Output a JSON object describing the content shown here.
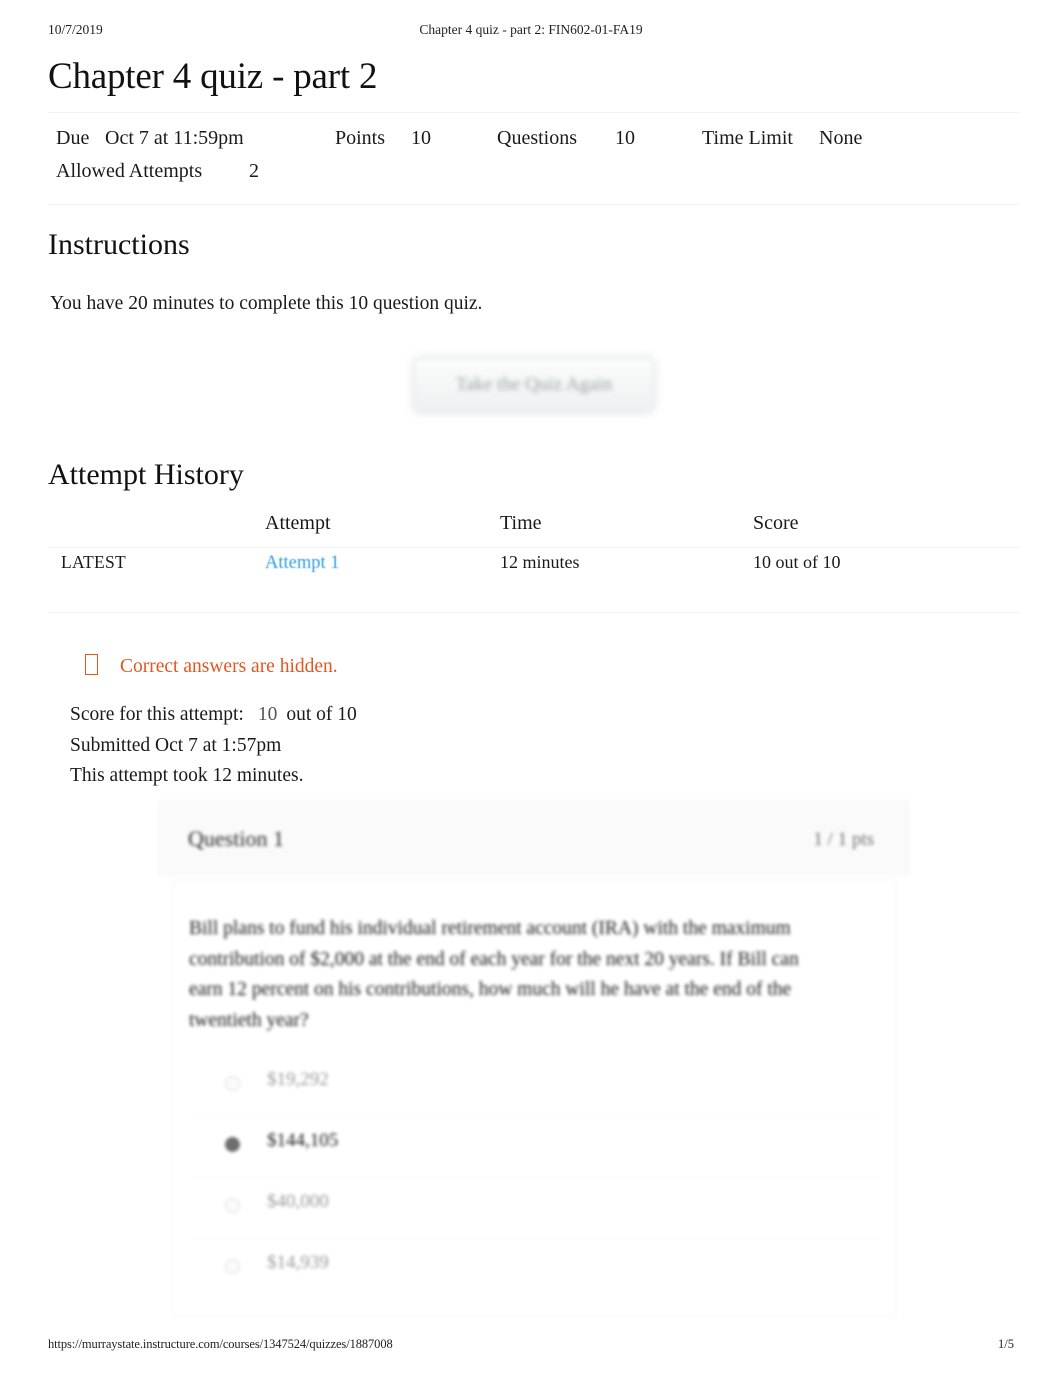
{
  "print_header": {
    "date": "10/7/2019",
    "title": "Chapter 4 quiz - part 2: FIN602-01-FA19"
  },
  "print_footer": {
    "url": "https://murraystate.instructure.com/courses/1347524/quizzes/1887008",
    "page": "1/5"
  },
  "quiz": {
    "title": "Chapter 4 quiz - part 2",
    "details": {
      "due_label": "Due",
      "due_value": "Oct 7 at 11:59pm",
      "points_label": "Points",
      "points_value": "10",
      "questions_label": "Questions",
      "questions_value": "10",
      "time_limit_label": "Time Limit",
      "time_limit_value": "None",
      "allowed_attempts_label": "Allowed Attempts",
      "allowed_attempts_value": "2"
    }
  },
  "instructions": {
    "heading": "Instructions",
    "body": "You have 20 minutes to complete this 10 question quiz."
  },
  "retake_button": {
    "label": "Take the Quiz Again"
  },
  "attempt_history": {
    "heading": "Attempt History",
    "columns": [
      "",
      "Attempt",
      "Time",
      "Score"
    ],
    "rows": [
      {
        "flag": "LATEST",
        "attempt": "Attempt 1",
        "time": "12 minutes",
        "score": "10 out of 10"
      }
    ]
  },
  "notice": {
    "icon": "warning-icon",
    "text": "Correct answers are hidden.",
    "color": "#e0571f"
  },
  "attempt_summary": {
    "score_label": "Score for this attempt:",
    "score_value": "10",
    "score_outof": "out of 10",
    "submitted": "Submitted Oct 7 at 1:57pm",
    "duration": "This attempt took 12 minutes."
  },
  "question": {
    "label": "Question 1",
    "points": "1 / 1 pts",
    "text": "Bill plans to fund his individual retirement account (IRA) with the maximum contribution of $2,000 at the end of each year for the next 20 years. If Bill can earn 12 percent on his contributions, how much will he have at the end of the twentieth year?",
    "answers": [
      {
        "text": "$19,292",
        "selected": false
      },
      {
        "text": "$144,105",
        "selected": true
      },
      {
        "text": "$40,000",
        "selected": false
      },
      {
        "text": "$14,939",
        "selected": false
      }
    ]
  }
}
